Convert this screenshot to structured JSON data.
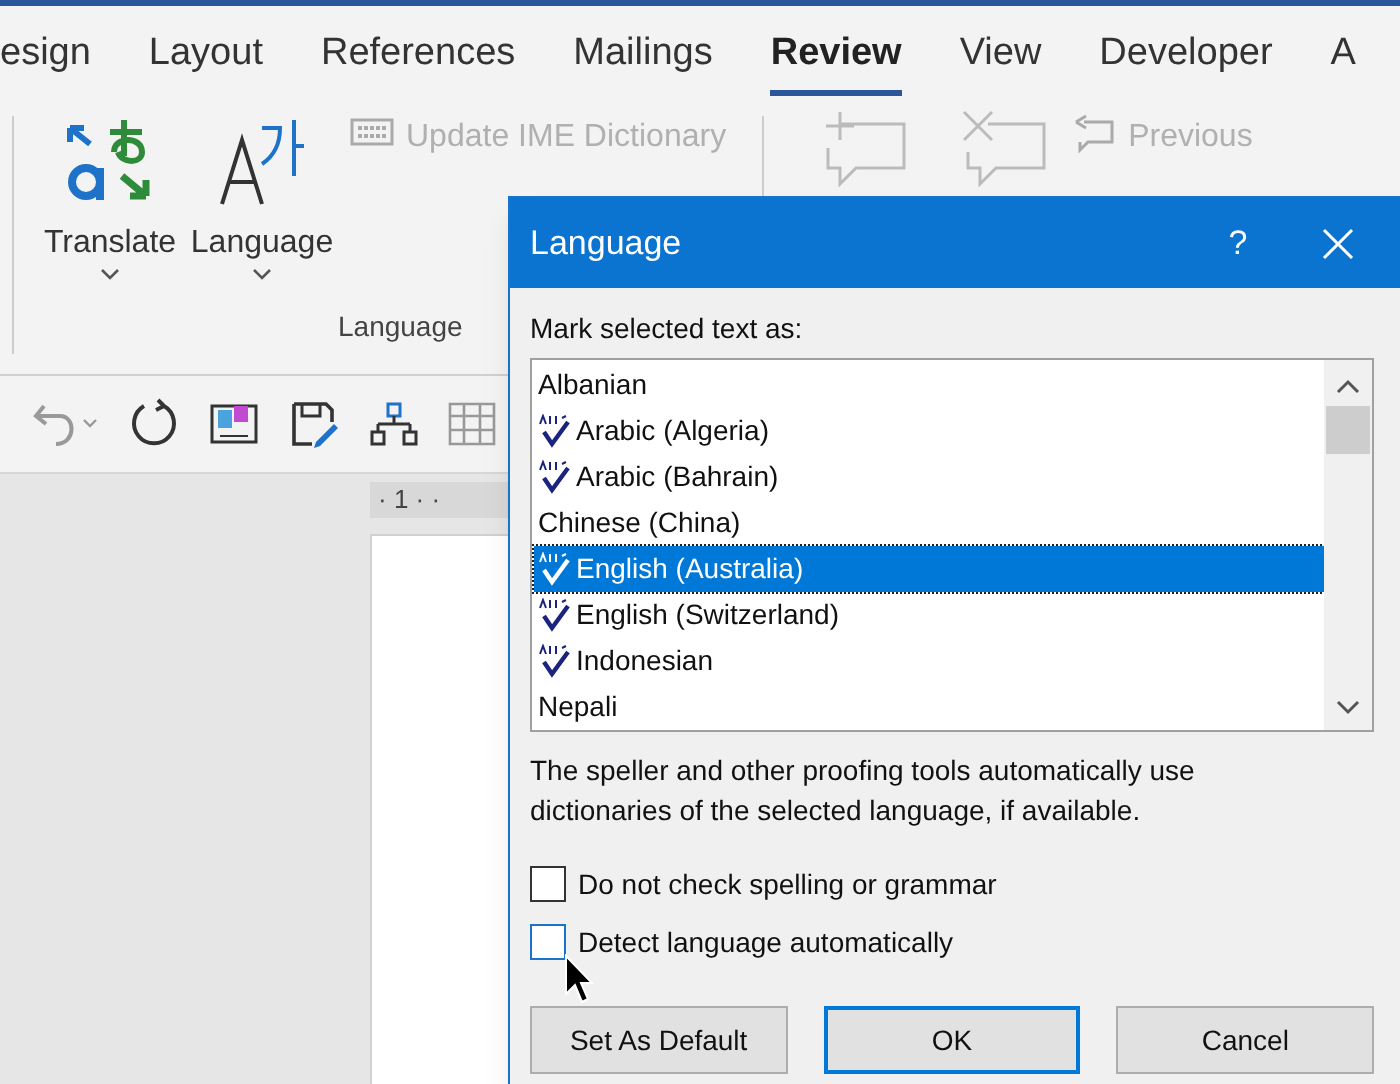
{
  "ribbon_tabs": [
    {
      "label": "esign",
      "selected": false
    },
    {
      "label": "Layout",
      "selected": false
    },
    {
      "label": "References",
      "selected": false
    },
    {
      "label": "Mailings",
      "selected": false
    },
    {
      "label": "Review",
      "selected": true
    },
    {
      "label": "View",
      "selected": false
    },
    {
      "label": "Developer",
      "selected": false
    },
    {
      "label": "A",
      "selected": false
    }
  ],
  "ribbon": {
    "big_buttons": [
      {
        "label": "Translate",
        "kind": "translate"
      },
      {
        "label": "Language",
        "kind": "language"
      }
    ],
    "update_ime": {
      "label": "Update IME Dictionary",
      "disabled": true
    },
    "group_label": "Language",
    "previous": {
      "label": "Previous",
      "disabled": true
    }
  },
  "ruler": "· 1 · ·",
  "dialog": {
    "title": "Language",
    "help": "?",
    "prompt": "Mark selected text as:",
    "languages": [
      {
        "name": "Albanian",
        "proofing": false,
        "selected": false
      },
      {
        "name": "Arabic (Algeria)",
        "proofing": true,
        "selected": false
      },
      {
        "name": "Arabic (Bahrain)",
        "proofing": true,
        "selected": false
      },
      {
        "name": "Chinese (China)",
        "proofing": false,
        "selected": false
      },
      {
        "name": "English (Australia)",
        "proofing": true,
        "selected": true
      },
      {
        "name": "English (Switzerland)",
        "proofing": true,
        "selected": false
      },
      {
        "name": "Indonesian",
        "proofing": true,
        "selected": false
      },
      {
        "name": "Nepali",
        "proofing": false,
        "selected": false
      }
    ],
    "note": "The speller and other proofing tools automatically use dictionaries of the selected language, if available.",
    "options": [
      {
        "label": "Do not check spelling or grammar",
        "checked": false,
        "hovered": false
      },
      {
        "label": "Detect language automatically",
        "checked": false,
        "hovered": true
      }
    ],
    "buttons": [
      {
        "label": "Set As Default",
        "default": false
      },
      {
        "label": "OK",
        "default": true
      },
      {
        "label": "Cancel",
        "default": false
      }
    ]
  }
}
